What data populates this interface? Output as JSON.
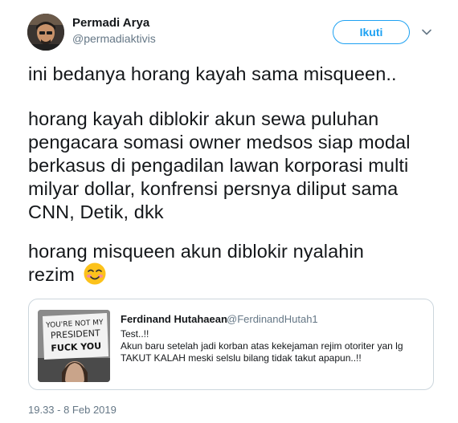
{
  "author": {
    "name": "Permadi Arya",
    "handle": "@permadiaktivis"
  },
  "follow_button": {
    "label": "Ikuti"
  },
  "menu_icon": "chevron-down-icon",
  "tweet_text": [
    "ini bedanya horang kayah sama misqueen..",
    "horang kayah diblokir akun sewa puluhan",
    "pengacara somasi owner medsos siap modal",
    "berkasus di pengadilan lawan korporasi multi",
    "milyar dollar, konfrensi persnya diliput sama",
    "CNN, Detik, dkk",
    "horang misqueen akun diblokir nyalahin",
    "rezim"
  ],
  "emoji": "smiling-face-with-blushing-cheeks",
  "quoted_tweet": {
    "name": "Ferdinand Hutahaean",
    "handle": "@FerdinandHutah1",
    "lines": [
      "Test..!!",
      "Akun baru setelah jadi korban atas kekejaman rejim otoriter yan lg",
      "TAKUT KALAH meski selslu bilang tidak takut apapun..!!"
    ],
    "media": {
      "sign_text": [
        "YOU'RE NOT MY",
        "PRESIDENT",
        "FUCK YOU"
      ]
    }
  },
  "timestamp": "19.33 - 8 Feb 2019",
  "colors": {
    "accent": "#1da1f2",
    "text": "#14171a",
    "muted": "#657786",
    "border": "#ccd6dd"
  }
}
